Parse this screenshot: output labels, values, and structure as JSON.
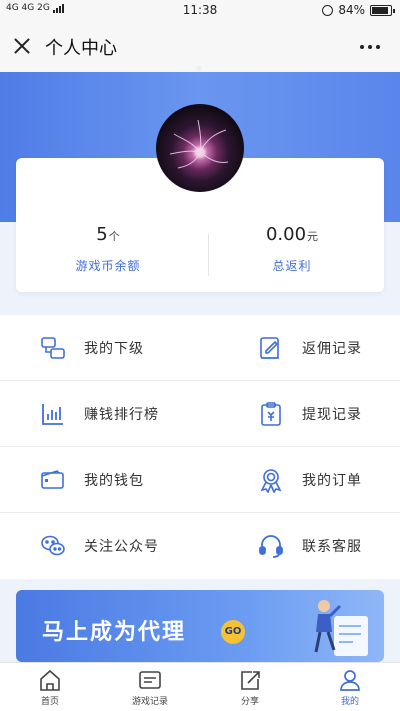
{
  "status_bar": {
    "network": "4G 4G 2G",
    "time": "11:38",
    "battery": "84%"
  },
  "nav": {
    "title": "个人中心"
  },
  "profile": {
    "name": "*"
  },
  "stats": [
    {
      "value": "5",
      "unit": "个",
      "label": "游戏币余额"
    },
    {
      "value": "0.00",
      "unit": "元",
      "label": "总返利"
    }
  ],
  "menu": [
    {
      "label": "我的下级",
      "icon": "subordinates-icon"
    },
    {
      "label": "返佣记录",
      "icon": "commission-record-icon"
    },
    {
      "label": "赚钱排行榜",
      "icon": "ranking-chart-icon"
    },
    {
      "label": "提现记录",
      "icon": "withdraw-record-icon"
    },
    {
      "label": "我的钱包",
      "icon": "wallet-icon"
    },
    {
      "label": "我的订单",
      "icon": "order-badge-icon"
    },
    {
      "label": "关注公众号",
      "icon": "wechat-icon"
    },
    {
      "label": "联系客服",
      "icon": "headset-icon"
    }
  ],
  "banner": {
    "text": "马上成为代理",
    "go": "GO"
  },
  "tabbar": [
    {
      "label": "首页",
      "icon": "home-icon"
    },
    {
      "label": "游戏记录",
      "icon": "game-record-icon"
    },
    {
      "label": "分享",
      "icon": "share-icon"
    },
    {
      "label": "我的",
      "icon": "user-icon",
      "active": true
    }
  ],
  "colors": {
    "accent": "#3f6fd8",
    "hero": "#5a86ec",
    "background": "#eef2fb"
  }
}
